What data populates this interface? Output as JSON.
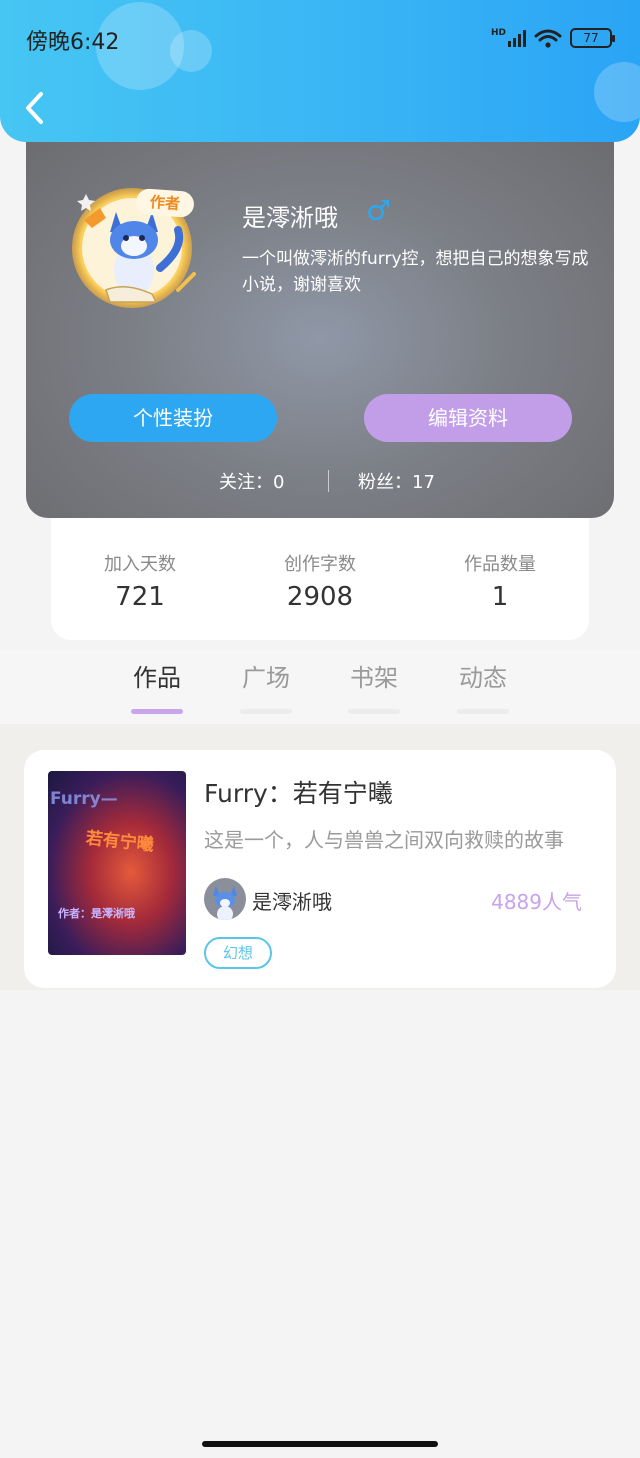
{
  "status_bar": {
    "time": "傍晚6:42",
    "battery": "77",
    "network": "HD"
  },
  "profile": {
    "name": "是澪淅哦",
    "gender_symbol": "♂",
    "bio": "一个叫做澪淅的furry控，想把自己的想象写成小说，谢谢喜欢",
    "badge": "作者",
    "buttons": {
      "dress_up": "个性装扮",
      "edit_profile": "编辑资料"
    },
    "following": "关注：0",
    "followers": "粉丝：17"
  },
  "stats": [
    {
      "label": "加入天数",
      "value": "721"
    },
    {
      "label": "创作字数",
      "value": "2908"
    },
    {
      "label": "作品数量",
      "value": "1"
    }
  ],
  "tabs": [
    {
      "label": "作品",
      "active": true
    },
    {
      "label": "广场",
      "active": false
    },
    {
      "label": "书架",
      "active": false
    },
    {
      "label": "动态",
      "active": false
    }
  ],
  "works": [
    {
      "title": "Furry：若有宁曦",
      "description": "这是一个，人与兽兽之间双向救赎的故事",
      "author": "是澪淅哦",
      "popularity": "4889人气",
      "tag": "幻想",
      "cover_text": {
        "top": "Furry—",
        "main": "若有宁曦",
        "byline": "作者：是澪淅哦"
      }
    }
  ],
  "colors": {
    "header_start": "#46c6f3",
    "header_end": "#2aa4f5",
    "dress_button": "#2ea7f3",
    "edit_button": "#c29ee8",
    "popularity": "#c8a2ea",
    "tag": "#5bc5e8",
    "tab_indicator": "#c9a5ec"
  }
}
